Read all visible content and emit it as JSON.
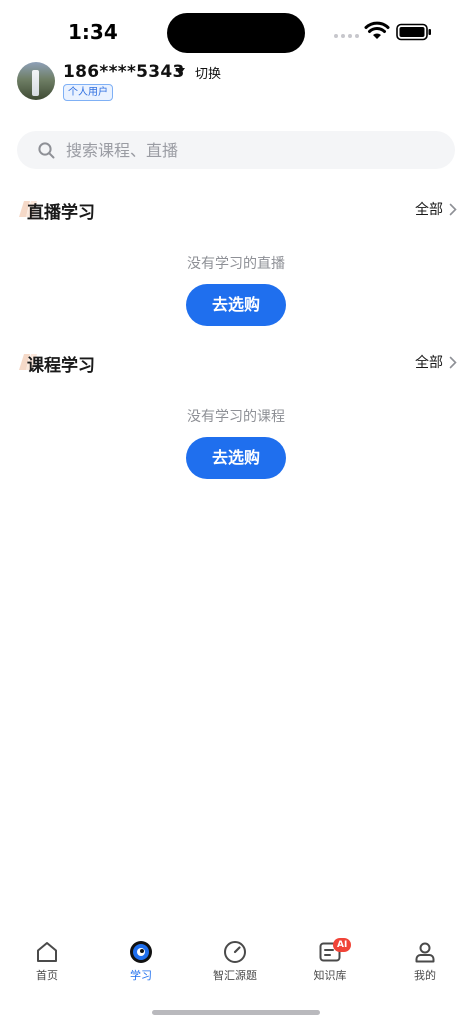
{
  "status_bar": {
    "time": "1:34"
  },
  "profile": {
    "phone": "186****5343",
    "switch_label": "切换",
    "user_type": "个人用户"
  },
  "search": {
    "placeholder": "搜索课程、直播"
  },
  "sections": [
    {
      "title": "直播学习",
      "all_label": "全部",
      "empty_text": "没有学习的直播",
      "button_label": "去选购"
    },
    {
      "title": "课程学习",
      "all_label": "全部",
      "empty_text": "没有学习的课程",
      "button_label": "去选购"
    }
  ],
  "tab_bar": {
    "active_tab": "学习",
    "accent_color": "#1f6fee",
    "items": [
      {
        "label": "首页",
        "icon": "home-icon"
      },
      {
        "label": "学习",
        "icon": "study-icon"
      },
      {
        "label": "智汇源题",
        "icon": "compass-icon"
      },
      {
        "label": "知识库",
        "icon": "knowledge-icon",
        "badge": "AI"
      },
      {
        "label": "我的",
        "icon": "user-icon"
      }
    ]
  }
}
